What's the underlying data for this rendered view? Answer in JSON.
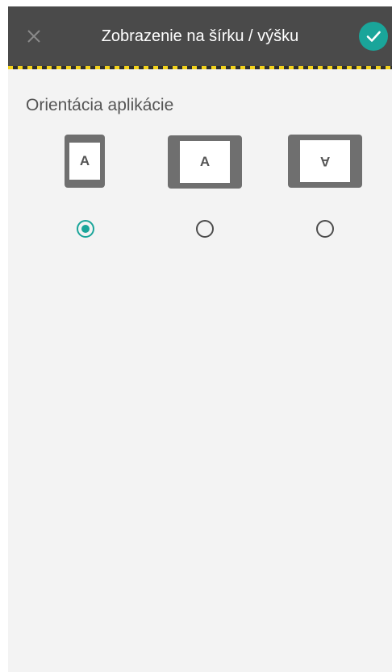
{
  "header": {
    "title": "Zobrazenie na šírku / výšku",
    "close_icon": "close-icon",
    "confirm_icon": "check-icon",
    "accent_color": "#1aa59a",
    "bar_color": "#4a4a4a"
  },
  "section": {
    "label": "Orientácia aplikácie"
  },
  "orientations": [
    {
      "icon": "portrait-orientation-icon",
      "letter": "A",
      "selected": true
    },
    {
      "icon": "landscape-orientation-icon",
      "letter": "A",
      "selected": false
    },
    {
      "icon": "reverse-landscape-orientation-icon",
      "letter": "A",
      "selected": false
    }
  ]
}
